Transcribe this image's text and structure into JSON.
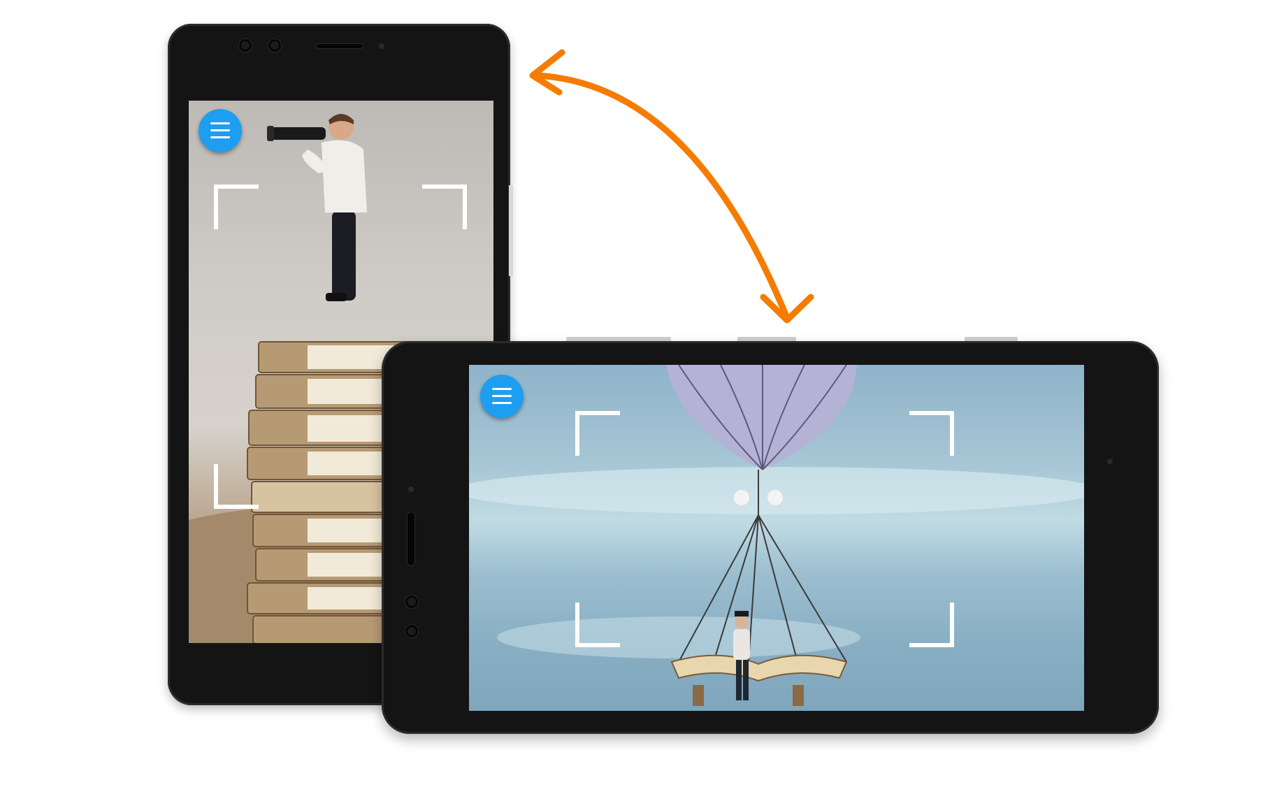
{
  "portrait_phone": {
    "menu_button": {
      "icon": "hamburger-menu-icon",
      "color": "#1e9ef0"
    },
    "scene_icon": "man-with-telescope-on-books-image"
  },
  "landscape_phone": {
    "menu_button": {
      "icon": "hamburger-menu-icon",
      "color": "#1e9ef0"
    },
    "scene_icon": "balloon-book-swing-image"
  },
  "rotation_arrow": {
    "icon": "rotate-double-arrow-icon",
    "color": "#f57c00"
  },
  "viewfinder_color": "#ffffff"
}
